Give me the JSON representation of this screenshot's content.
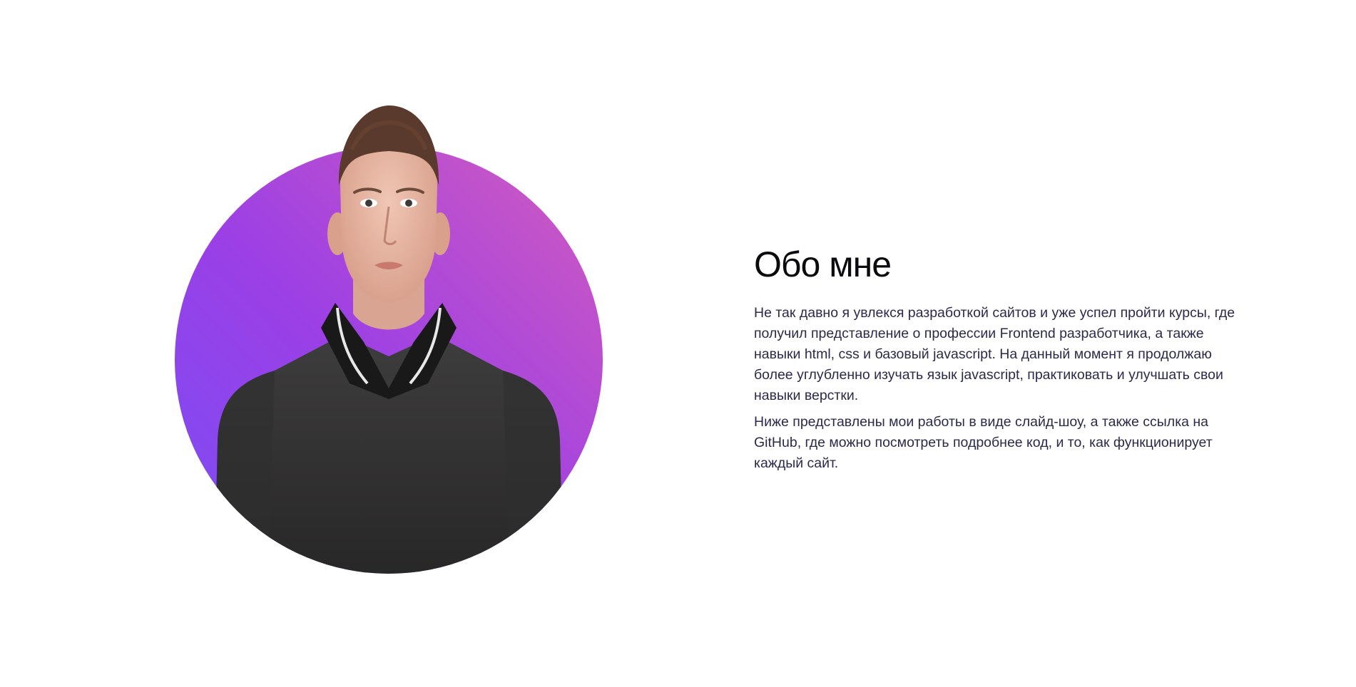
{
  "about": {
    "title": "Обо мне",
    "paragraphs": [
      "Не так давно я увлекся разработкой сайтов и уже успел пройти курсы, где получил представление о профессии Frontend разработчика, а также навыки html, css и базовый javascript. На данный момент я продолжаю более углубленно изучать язык javascript, практиковать и улучшать свои навыки верстки.",
      "Ниже представлены мои работы в виде слайд-шоу, а также ссылка на GitHub, где можно посмотреть подробнее код, и то, как функционирует каждый сайт."
    ],
    "photo": {
      "icon": "portrait-photo",
      "gradient_colors": [
        "#7b4df4",
        "#9b3fe6",
        "#d35cbd"
      ]
    }
  },
  "colors": {
    "title": "#0b0b0f",
    "text": "#2b2a4a",
    "background": "#ffffff"
  }
}
